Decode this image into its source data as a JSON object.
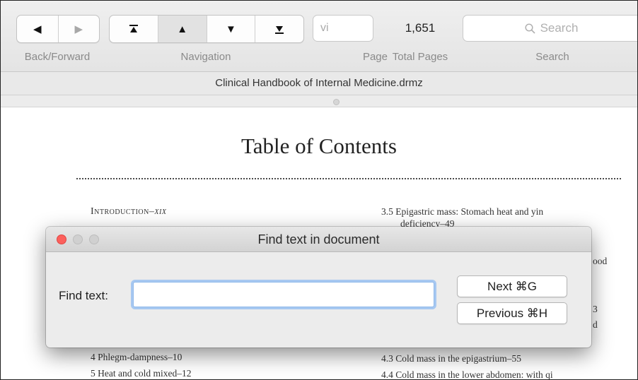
{
  "toolbar": {
    "back_forward": {
      "back_glyph": "◀",
      "forward_glyph": "▶",
      "label": "Back/Forward"
    },
    "navigation": {
      "first_glyph": "⏫",
      "prev_glyph": "▲",
      "next_glyph": "▼",
      "last_glyph": "⏬",
      "label": "Navigation"
    },
    "page": {
      "value": "vi",
      "label": "Page"
    },
    "total_pages": {
      "value": "1,651",
      "label": "Total Pages"
    },
    "search": {
      "placeholder": "Search",
      "label": "Search"
    }
  },
  "document": {
    "filename": "Clinical Handbook of Internal Medicine.drmz",
    "toc_title": "Table of Contents",
    "left_entries": [
      {
        "prefix": "Introduction–",
        "suffix": "xix"
      },
      {
        "text": "4 Phlegm-dampness–10"
      },
      {
        "text": "5 Heat and cold mixed–12"
      }
    ],
    "right_entries": [
      {
        "text": "3.5 Epigastric mass: Stomach heat and yin"
      },
      {
        "text": "deficiency–49"
      },
      {
        "text": "ood"
      },
      {
        "text": "3"
      },
      {
        "text": "d"
      },
      {
        "text": "4.3 Cold mass in the epigastrium–55"
      },
      {
        "text": "4.4 Cold mass in the lower abdomen: with qi"
      }
    ]
  },
  "dialog": {
    "title": "Find text in document",
    "find_label": "Find text:",
    "find_value": "",
    "next_button": "Next ⌘G",
    "previous_button": "Previous ⌘H"
  }
}
